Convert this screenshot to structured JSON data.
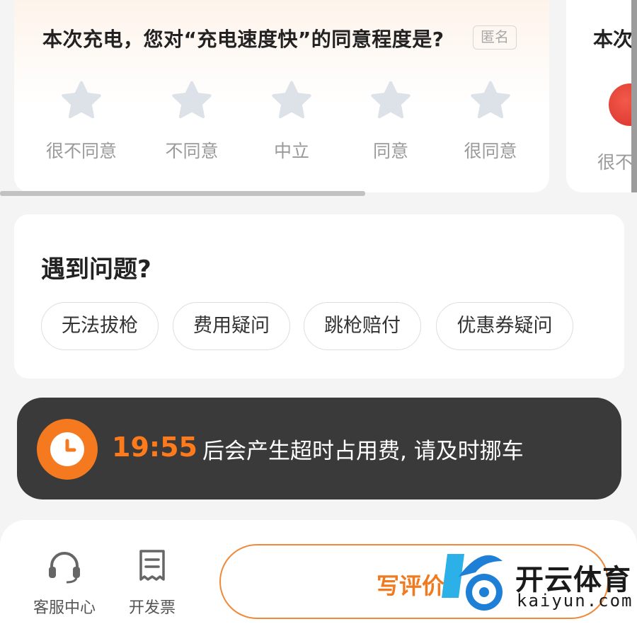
{
  "survey": {
    "title": "本次充电，您对“充电速度快”的同意程度是?",
    "anonymous_badge": "匿名",
    "options": [
      {
        "label": "很不同意",
        "selected": false
      },
      {
        "label": "不同意",
        "selected": false
      },
      {
        "label": "中立",
        "selected": false
      },
      {
        "label": "同意",
        "selected": false
      },
      {
        "label": "很同意",
        "selected": false
      }
    ]
  },
  "next_survey_peek": {
    "title_partial": "本次",
    "label_partial": "很不"
  },
  "issues": {
    "title": "遇到问题?",
    "chips": [
      "无法拔枪",
      "费用疑问",
      "跳枪赔付",
      "优惠券疑问"
    ]
  },
  "timer": {
    "value": "19:55",
    "message": "后会产生超时占用费, 请及时挪车"
  },
  "bottom_nav": {
    "support_label": "客服中心",
    "invoice_label": "开发票",
    "review_button_label": "写评价"
  },
  "watermark": {
    "brand": "开云体育",
    "url": "kaiyun.com"
  },
  "colors": {
    "accent": "#f57a1f",
    "star_inactive": "#dde2e8",
    "banner_bg": "#3a3a3a"
  }
}
